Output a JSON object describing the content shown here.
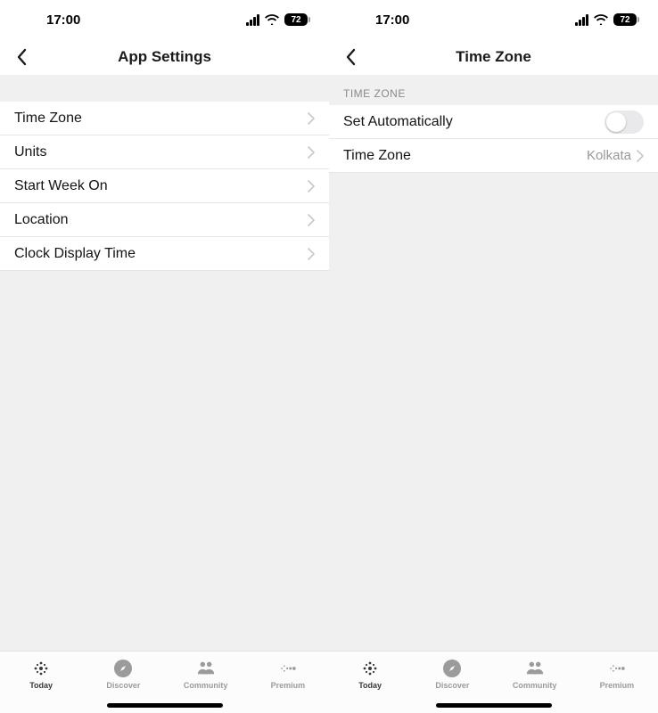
{
  "status": {
    "time": "17:00",
    "battery": "72"
  },
  "screens": [
    {
      "title": "App Settings",
      "rows": [
        {
          "label": "Time Zone"
        },
        {
          "label": "Units"
        },
        {
          "label": "Start Week On"
        },
        {
          "label": "Location"
        },
        {
          "label": "Clock Display Time"
        }
      ]
    },
    {
      "title": "Time Zone",
      "sectionHeader": "TIME ZONE",
      "setAuto": {
        "label": "Set Automatically"
      },
      "tzRow": {
        "label": "Time Zone",
        "value": "Kolkata"
      }
    }
  ],
  "tabs": {
    "today": "Today",
    "discover": "Discover",
    "community": "Community",
    "premium": "Premium"
  }
}
